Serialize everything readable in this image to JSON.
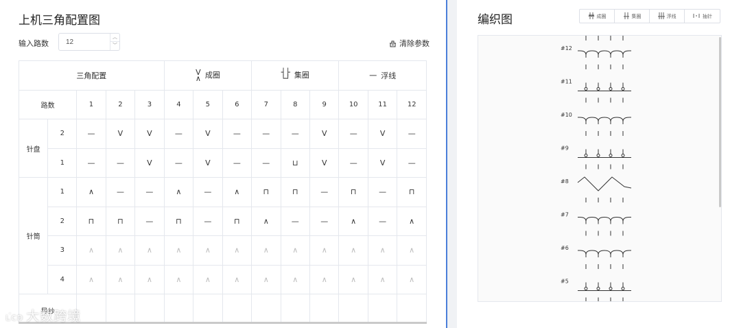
{
  "config": {
    "title": "上机三角配置图",
    "route_label": "输入路数",
    "route_value": "12",
    "clear_label": "清除参数",
    "header_group_config": "三角配置",
    "header_knit_symbol": "V\n∧",
    "header_knit": "成圈",
    "header_tuck_symbol": "∐",
    "header_tuck": "集圈",
    "header_float_symbol": "一",
    "header_float": "浮线",
    "header_route": "路数",
    "route_numbers": [
      "1",
      "2",
      "3",
      "4",
      "5",
      "6",
      "7",
      "8",
      "9",
      "10",
      "11",
      "12"
    ],
    "dial_label": "针盘",
    "cylinder_label": "针筒",
    "yarn_label": "导纱",
    "rows": [
      {
        "group": "dial",
        "idx": "2",
        "cells": [
          "—",
          "V",
          "V",
          "—",
          "V",
          "—",
          "—",
          "—",
          "V",
          "—",
          "V",
          "—"
        ],
        "faded": false
      },
      {
        "group": "dial",
        "idx": "1",
        "cells": [
          "—",
          "—",
          "V",
          "—",
          "V",
          "—",
          "—",
          "⊔",
          "V",
          "—",
          "V",
          "—"
        ],
        "faded": false
      },
      {
        "group": "cylinder",
        "idx": "1",
        "cells": [
          "∧",
          "—",
          "—",
          "∧",
          "—",
          "∧",
          "⊓",
          "⊓",
          "—",
          "⊓",
          "—",
          "⊓"
        ],
        "faded": false
      },
      {
        "group": "cylinder",
        "idx": "2",
        "cells": [
          "⊓",
          "⊓",
          "—",
          "⊓",
          "—",
          "⊓",
          "∧",
          "—",
          "—",
          "∧",
          "—",
          "∧"
        ],
        "faded": false
      },
      {
        "group": "cylinder",
        "idx": "3",
        "cells": [
          "∧",
          "∧",
          "∧",
          "∧",
          "∧",
          "∧",
          "∧",
          "∧",
          "∧",
          "∧",
          "∧",
          "∧"
        ],
        "faded": true
      },
      {
        "group": "cylinder",
        "idx": "4",
        "cells": [
          "∧",
          "∧",
          "∧",
          "∧",
          "∧",
          "∧",
          "∧",
          "∧",
          "∧",
          "∧",
          "∧",
          "∧"
        ],
        "faded": true
      }
    ]
  },
  "diagram": {
    "title": "编织图",
    "toolbar": [
      {
        "label": "成圈",
        "icon": "knit-icon"
      },
      {
        "label": "集圈",
        "icon": "tuck-icon"
      },
      {
        "label": "浮线",
        "icon": "float-icon"
      },
      {
        "label": "抽针",
        "icon": "remove-needle-icon"
      }
    ],
    "rows": [
      {
        "label": "#12",
        "type": "knit"
      },
      {
        "label": "#11",
        "type": "tuck"
      },
      {
        "label": "#10",
        "type": "knit"
      },
      {
        "label": "#9",
        "type": "tuck"
      },
      {
        "label": "#8",
        "type": "cross"
      },
      {
        "label": "#7",
        "type": "knit"
      },
      {
        "label": "#6",
        "type": "knit"
      },
      {
        "label": "#5",
        "type": "tuck"
      }
    ]
  },
  "watermark": "大数跨境",
  "colors": {
    "accent": "#4a7ed9",
    "border": "#e4e7ed",
    "text": "#333333"
  }
}
